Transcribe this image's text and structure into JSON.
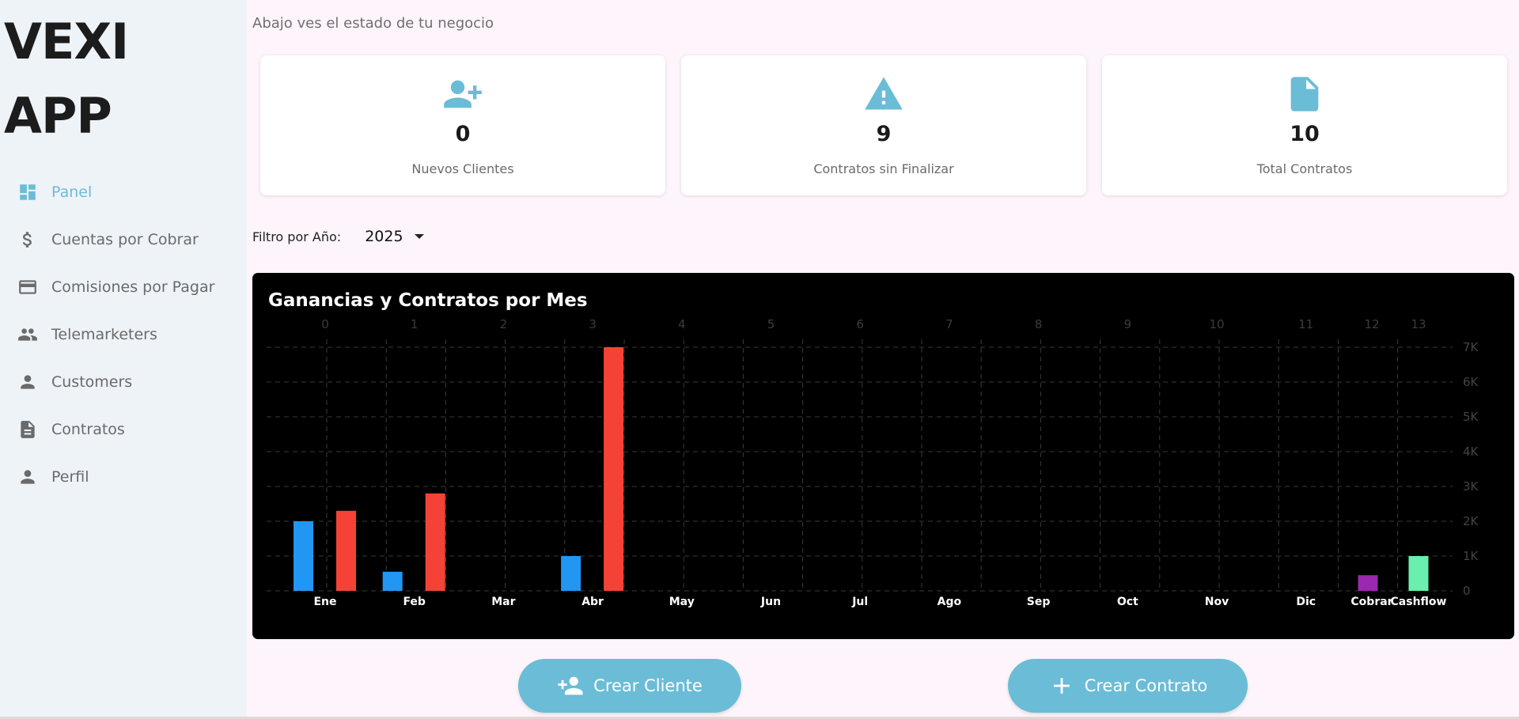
{
  "app": {
    "logo_line1": "VEXI",
    "logo_line2": "APP"
  },
  "header": {
    "subtitle": "Abajo ves el estado de tu negocio"
  },
  "sidebar": {
    "items": [
      {
        "label": "Panel",
        "icon": "dashboard-icon",
        "active": true
      },
      {
        "label": "Cuentas por Cobrar",
        "icon": "dollar-icon",
        "active": false
      },
      {
        "label": "Comisiones por Pagar",
        "icon": "credit-card-icon",
        "active": false
      },
      {
        "label": "Telemarketers",
        "icon": "people-icon",
        "active": false
      },
      {
        "label": "Customers",
        "icon": "person-icon",
        "active": false
      },
      {
        "label": "Contratos",
        "icon": "document-icon",
        "active": false
      },
      {
        "label": "Perfil",
        "icon": "person-icon",
        "active": false
      }
    ]
  },
  "cards": [
    {
      "value": "0",
      "label": "Nuevos Clientes",
      "icon": "person-add-icon"
    },
    {
      "value": "9",
      "label": "Contratos sin Finalizar",
      "icon": "warning-icon"
    },
    {
      "value": "10",
      "label": "Total Contratos",
      "icon": "file-icon"
    }
  ],
  "filter": {
    "label": "Filtro por Año:",
    "selected": "2025"
  },
  "colors": {
    "accent": "#6bbcd6",
    "blue": "#2196f3",
    "red": "#f44336",
    "purple": "#9c27b0",
    "green": "#69f0ae"
  },
  "chart_data": {
    "type": "bar",
    "title": "Ganancias y Contratos por Mes",
    "categories": [
      "Ene",
      "Feb",
      "Mar",
      "Abr",
      "May",
      "Jun",
      "Jul",
      "Ago",
      "Sep",
      "Oct",
      "Nov",
      "Dic",
      "Cobrar",
      "Cashflow"
    ],
    "top_ticks": [
      "0",
      "1",
      "2",
      "3",
      "4",
      "5",
      "6",
      "7",
      "8",
      "9",
      "10",
      "11",
      "12",
      "13"
    ],
    "y_ticks": [
      "0",
      "1K",
      "2K",
      "3K",
      "4K",
      "5K",
      "6K",
      "7K"
    ],
    "ylim": [
      0,
      7000
    ],
    "grid": true,
    "series": [
      {
        "color": "#2196f3",
        "values": [
          2000,
          550,
          0,
          1000,
          0,
          0,
          0,
          0,
          0,
          0,
          0,
          0,
          null,
          null
        ]
      },
      {
        "color": "#f44336",
        "values": [
          2300,
          2800,
          0,
          7000,
          0,
          0,
          0,
          0,
          0,
          0,
          0,
          0,
          null,
          null
        ]
      },
      {
        "color": "#9c27b0",
        "values": [
          null,
          null,
          null,
          null,
          null,
          null,
          null,
          null,
          null,
          null,
          null,
          null,
          450,
          null
        ]
      },
      {
        "color": "#69f0ae",
        "values": [
          null,
          null,
          null,
          null,
          null,
          null,
          null,
          null,
          null,
          null,
          null,
          null,
          null,
          1000
        ]
      }
    ]
  },
  "buttons": {
    "create_client": {
      "label": "Crear Cliente",
      "icon": "person-add-icon"
    },
    "create_contract": {
      "label": "Crear Contrato",
      "icon": "plus-icon"
    }
  }
}
